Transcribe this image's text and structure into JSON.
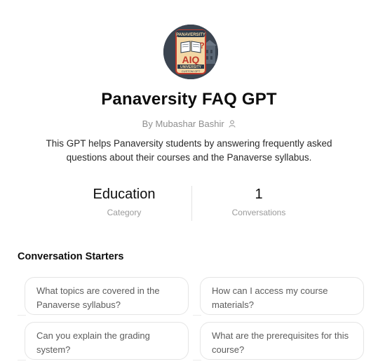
{
  "gpt": {
    "avatar": {
      "top_text": "PANAVERSITY",
      "logo_text": "AIQ",
      "university_text": "UNIVERSITY",
      "sub_text": "CUSTOM GPT",
      "colors": {
        "bg": "#3b4450",
        "badge": "#f3d7a5",
        "badge_border": "#c0392b",
        "logo": "#c0392b"
      }
    },
    "title": "Panaversity FAQ GPT",
    "author": "By Mubashar Bashir",
    "author_icon": "person-icon",
    "description": "This GPT helps Panaversity students by answering frequently asked questions about their courses and the Panaverse syllabus."
  },
  "stats": {
    "category": {
      "value": "Education",
      "label": "Category"
    },
    "conversations": {
      "value": "1",
      "label": "Conversations"
    }
  },
  "starters": {
    "heading": "Conversation Starters",
    "items": [
      "What topics are covered in the Panaverse syllabus?",
      "How can I access my course materials?",
      "Can you explain the grading system?",
      "What are the prerequisites for this course?"
    ]
  }
}
